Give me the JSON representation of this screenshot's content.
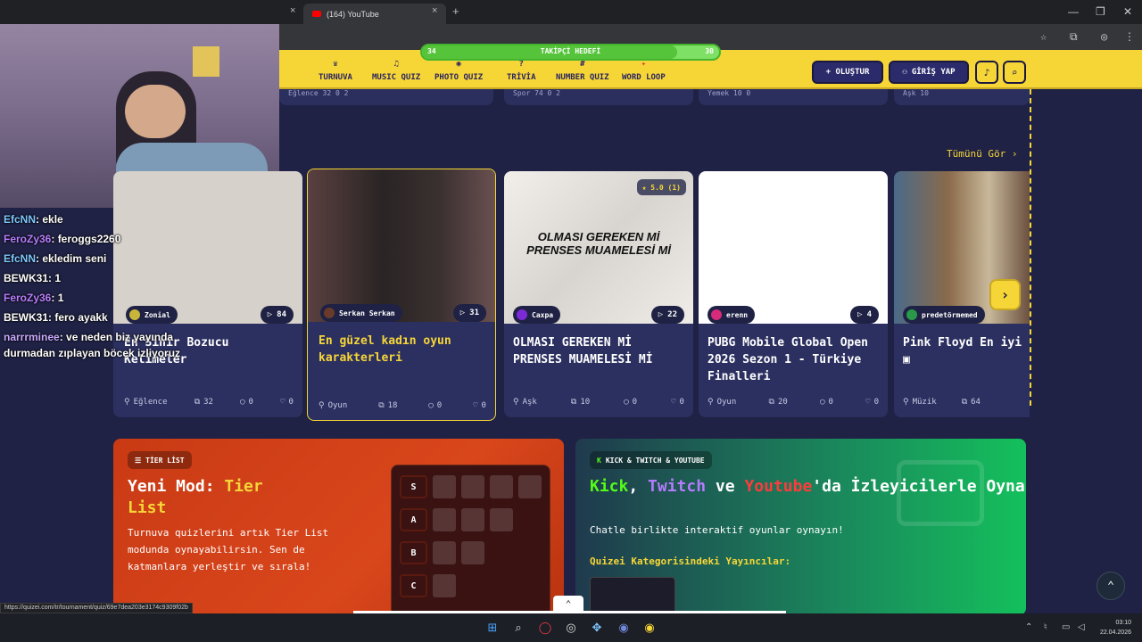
{
  "browser": {
    "tab_label": "(164) YouTube",
    "new_tab": "+",
    "tab_close": "×"
  },
  "progress": {
    "label": "TAKİPÇİ HEDEFİ",
    "current": "34",
    "target": "30",
    "fraction": 0.86
  },
  "nav": {
    "items": [
      {
        "icon": "♛",
        "label": "TURNUVA"
      },
      {
        "icon": "♫",
        "label": "MUSIC QUIZ"
      },
      {
        "icon": "◉",
        "label": "PHOTO QUIZ"
      },
      {
        "icon": "?",
        "label": "TRİVİA"
      },
      {
        "icon": "#",
        "label": "NUMBER QUIZ"
      },
      {
        "icon": "✦",
        "label": "WORD LOOP"
      }
    ],
    "create_label": "+ OLUŞTUR",
    "login_label": "GİRİŞ YAP",
    "bell_icon": "🔔",
    "search_icon": "⌕"
  },
  "prev_strip": [
    "Eğlence  32  0  2",
    "Spor  74  0  2",
    "Yemek  10  0",
    "Aşk  10"
  ],
  "see_all": "Tümünü Gör ›",
  "cards": [
    {
      "author": "Zonial",
      "plays": "84",
      "title": "En Sinir Bozucu Kelimeler",
      "category": "Eğlence",
      "items": "32",
      "comments": "0",
      "likes": "0",
      "thumb": "#d7d1cb",
      "avatar": "#c9b53a"
    },
    {
      "author": "Serkan Serkan",
      "plays": "31",
      "title": "En güzel kadın oyun karakterleri",
      "category": "Oyun",
      "items": "18",
      "comments": "0",
      "likes": "0",
      "thumb": "#4a3a3a",
      "avatar": "#6a3a2a"
    },
    {
      "author": "Caxpa",
      "plays": "22",
      "title": "OLMASI GEREKEN Mİ PRENSES MUAMELESİ Mİ",
      "category": "Aşk",
      "items": "10",
      "comments": "0",
      "likes": "0",
      "thumb": "#ece8e4",
      "avatar": "#7a2ad6",
      "thumb_text": "OLMASI GEREKEN Mİ PRENSES MUAMELESİ Mİ",
      "rating": "★ 5.0 (1)"
    },
    {
      "author": "erenn",
      "plays": "4",
      "title": "PUBG Mobile Global Open 2026 Sezon 1 - Türkiye Finalleri",
      "category": "Oyun",
      "items": "20",
      "comments": "0",
      "likes": "0",
      "thumb": "#ffffff",
      "avatar": "#d62a7a"
    },
    {
      "author": "predetörmemed",
      "plays": "",
      "title": "Pink Floyd En iyi",
      "category": "Müzik",
      "items": "64",
      "comments": "",
      "likes": "",
      "thumb": "#6a7a86",
      "avatar": "#2a9a4a"
    }
  ],
  "tier_banner": {
    "badge": "TİER LİST",
    "title_plain": "Yeni Mod: ",
    "title_hl": "Tier List",
    "desc": "Turnuva quizlerini artık Tier List modunda oynayabilirsin. Sen de katmanlara yerleştir ve sırala!",
    "tiers": [
      "S",
      "A",
      "B",
      "C"
    ]
  },
  "stream_banner": {
    "badge": "KICK & TWITCH & YOUTUBE",
    "kick": "Kick",
    "twitch": "Twitch",
    "and": " ve ",
    "youtube": "Youtube",
    "rest": "'da İzleyicilerle Oyna",
    "comma": ", ",
    "desc": "Chatle birlikte interaktif oyunlar oynayın!",
    "sub": "Quizei Kategorisindeki Yayıncılar:"
  },
  "chat": [
    {
      "user": "EfcNN",
      "msg": ": ekle",
      "color": "#7fc8ff"
    },
    {
      "user": "FeroZy36",
      "msg": ": feroggs2260",
      "color": "#b97dff"
    },
    {
      "user": "EfcNN",
      "msg": ": ekledim seni",
      "color": "#7fc8ff"
    },
    {
      "user": "BEWK31",
      "msg": ": 1",
      "color": "#ffffff"
    },
    {
      "user": "FeroZy36",
      "msg": ": 1",
      "color": "#b97dff"
    },
    {
      "user": "BEWK31",
      "msg": ": fero ayakk",
      "color": "#ffffff"
    },
    {
      "user": "narrrminee",
      "msg": ": ve neden biz yayında",
      "color": "#c8a8ff"
    },
    {
      "user": "",
      "msg": "durmadan zıplayan böcek izliyoruz",
      "color": "#ffffff"
    }
  ],
  "status_url": "https://quizei.com/tr/tournament/quiz/69e7dea203e3174c9309f02b",
  "clock": {
    "time": "03:10",
    "date": "22.04.2026"
  },
  "colors": {
    "accent": "#f6d637",
    "bg": "#1f2244",
    "card": "#2c3060"
  }
}
